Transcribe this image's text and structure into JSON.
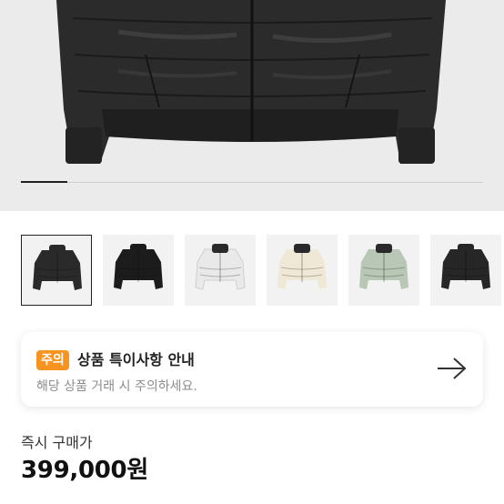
{
  "gallery": {
    "current_slide": 1,
    "slide_count": 10,
    "thumbnails": [
      {
        "name": "black-matte-jacket-thumbnail",
        "color": "#2a2a2a"
      },
      {
        "name": "black-glossy-jacket-thumbnail",
        "color": "#1c1c1c"
      },
      {
        "name": "white-jacket-thumbnail",
        "color": "#e9e9e9"
      },
      {
        "name": "cream-jacket-thumbnail",
        "color": "#efe8d6"
      },
      {
        "name": "sage-jacket-thumbnail",
        "color": "#b9c7b6"
      },
      {
        "name": "black-jacket-thumbnail-2",
        "color": "#262626"
      }
    ]
  },
  "notice": {
    "badge": "주의",
    "title": "상품 특이사항 안내",
    "subtitle": "해당 상품 거래 시 주의하세요.",
    "arrow_icon": "arrow-right-icon",
    "badge_color": "#f7931e"
  },
  "price": {
    "label": "즉시 구매가",
    "value": "399,000원"
  }
}
